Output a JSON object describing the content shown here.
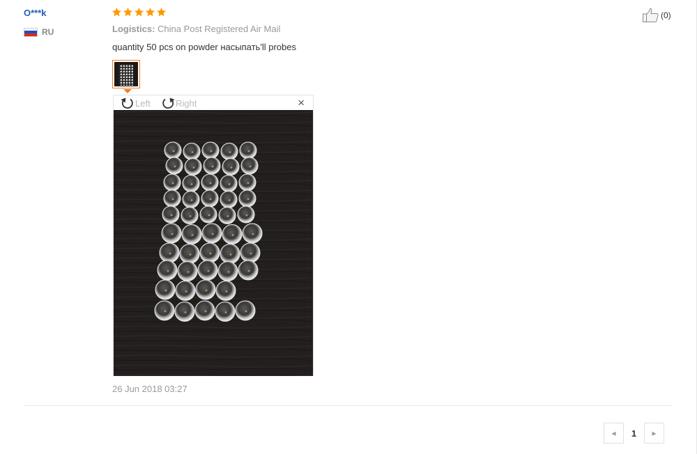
{
  "review": {
    "username": "O***k",
    "country_code": "RU",
    "rating": 5,
    "logistics_label": "Logistics:",
    "logistics_value": "China Post Registered Air Mail",
    "text": "quantity 50 pcs on powder насыпать'll probes",
    "date": "26 Jun 2018 03:27",
    "helpful_count": "(0)"
  },
  "viewer": {
    "rotate_left_label": "Left",
    "rotate_right_label": "Right",
    "close_symbol": "×"
  },
  "pagination": {
    "prev_symbol": "◂",
    "current_page": "1",
    "next_symbol": "▸"
  },
  "icons": {
    "star": "star-icon",
    "thumbs_up": "thumbs-up-icon",
    "rotate_left": "rotate-left-icon",
    "rotate_right": "rotate-right-icon"
  },
  "colors": {
    "username": "#1f5fb5",
    "star": "#ff9900",
    "thumbnail_border": "#f07c22",
    "muted_text": "#999999",
    "body_text": "#333333"
  }
}
